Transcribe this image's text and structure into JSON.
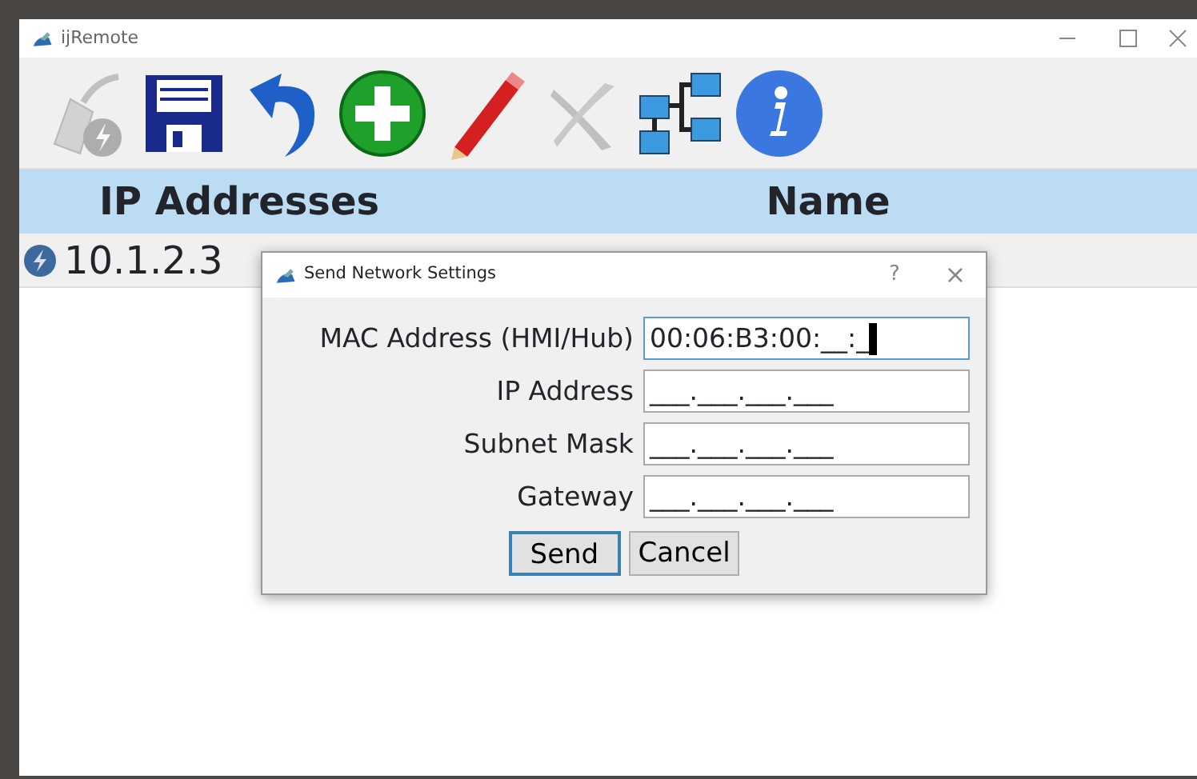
{
  "window": {
    "title": "ijRemote"
  },
  "toolbar": [
    {
      "kind": "connect",
      "disabled": true
    },
    {
      "kind": "save",
      "disabled": false
    },
    {
      "kind": "undo",
      "disabled": false
    },
    {
      "kind": "add",
      "disabled": false
    },
    {
      "kind": "edit",
      "disabled": false
    },
    {
      "kind": "delete",
      "disabled": true
    },
    {
      "kind": "network",
      "disabled": false
    },
    {
      "kind": "info",
      "disabled": false
    }
  ],
  "table": {
    "columns": [
      "IP Addresses",
      "Name"
    ],
    "rows": [
      {
        "ip": "10.1.2.3"
      }
    ]
  },
  "dialog": {
    "title": "Send Network Settings",
    "help": "?",
    "close": "×",
    "fields": [
      {
        "label": "MAC Address (HMI/Hub)",
        "value": "00:06:B3:00:__:_",
        "focused": true
      },
      {
        "label": "IP Address",
        "value": "___.___.___.___",
        "focused": false
      },
      {
        "label": "Subnet Mask",
        "value": "___.___.___.___",
        "focused": false
      },
      {
        "label": "Gateway",
        "value": "___.___.___.___",
        "focused": false
      }
    ],
    "buttons": [
      {
        "label": "Send",
        "default": true
      },
      {
        "label": "Cancel",
        "default": false
      }
    ]
  }
}
